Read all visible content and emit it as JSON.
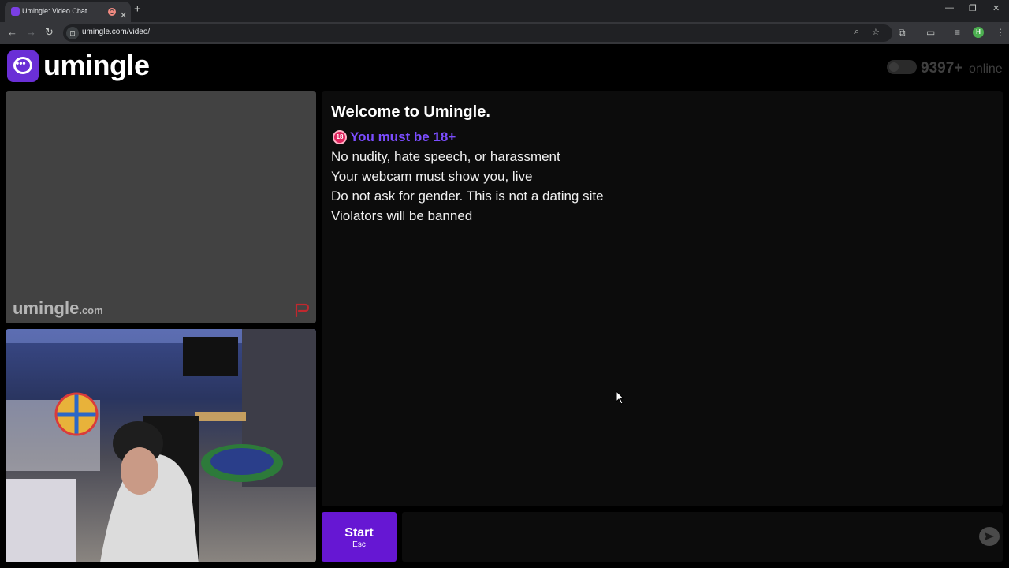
{
  "browser": {
    "tab_title": "Umingle: Video Chat with S",
    "tab_close": "✕",
    "new_tab": "+",
    "url": "umingle.com/video/",
    "window": {
      "minimize": "—",
      "restore": "❐",
      "close": "✕"
    },
    "profile_initial": "H"
  },
  "header": {
    "logo_text": "umingle",
    "online_count": "9397+",
    "online_label": "online"
  },
  "remote_video": {
    "watermark": "umingle",
    "watermark_suffix": ".com"
  },
  "chat": {
    "welcome": "Welcome to Umingle.",
    "age_badge": "18",
    "age_warning": "You must be 18+",
    "rules": [
      "No nudity, hate speech, or harassment",
      "Your webcam must show you, live",
      "Do not ask for gender. This is not a dating site",
      "Violators will be banned"
    ]
  },
  "controls": {
    "start_label": "Start",
    "start_hint": "Esc"
  },
  "colors": {
    "accent": "#6617d3",
    "age_warning": "#7b4dff"
  }
}
